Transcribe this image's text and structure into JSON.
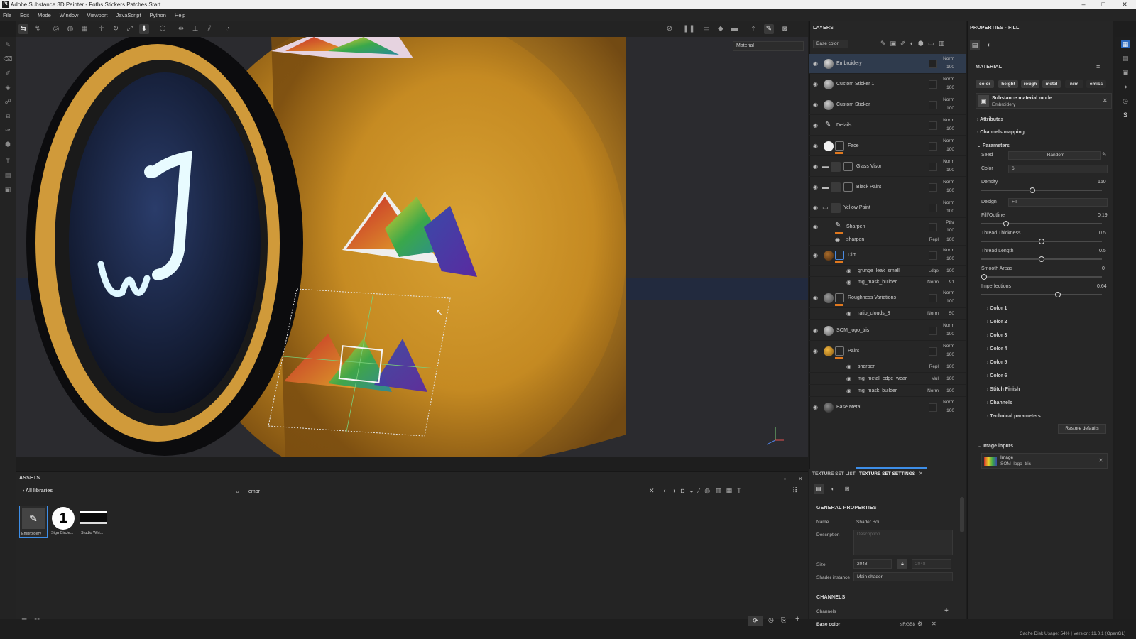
{
  "window": {
    "title": "Adobe Substance 3D Painter - Foths Stickers Patches Start",
    "app_icon": "Pt",
    "controls": {
      "minimize": "–",
      "maximize": "□",
      "close": "✕"
    }
  },
  "menu": [
    "File",
    "Edit",
    "Mode",
    "Window",
    "Viewport",
    "JavaScript",
    "Python",
    "Help"
  ],
  "viewport": {
    "material_dropdown": "Material"
  },
  "layers_panel": {
    "title": "LAYERS",
    "channel_dropdown": "Base color",
    "layers": [
      {
        "name": "Embroidery",
        "blend": "Norm",
        "opacity": "100",
        "selected": true
      },
      {
        "name": "Custom Sticker 1",
        "blend": "Norm",
        "opacity": "100"
      },
      {
        "name": "Custom Sticker",
        "blend": "Norm",
        "opacity": "100"
      },
      {
        "name": "Details",
        "blend": "Norm",
        "opacity": "100"
      },
      {
        "name": "Face",
        "blend": "Norm",
        "opacity": "100"
      },
      {
        "name": "Glass Visor",
        "blend": "Norm",
        "opacity": "100"
      },
      {
        "name": "Black Paint",
        "blend": "Norm",
        "opacity": "100"
      },
      {
        "name": "Yellow Paint",
        "blend": "Norm",
        "opacity": "100"
      },
      {
        "name": "Sharpen",
        "blend": "Pthr",
        "opacity": "100"
      },
      {
        "name": "Dirt",
        "blend": "Norm",
        "opacity": "100"
      },
      {
        "name": "Roughness Variations",
        "blend": "Norm",
        "opacity": "100"
      },
      {
        "name": "SOM_logo_tris",
        "blend": "Norm",
        "opacity": "100"
      },
      {
        "name": "Paint",
        "blend": "Norm",
        "opacity": "100"
      },
      {
        "name": "Base Metal",
        "blend": "Norm",
        "opacity": "100"
      }
    ],
    "effects": [
      {
        "name": "sharpen",
        "blend": "Repl",
        "opacity": "100"
      },
      {
        "name": "grunge_leak_small",
        "blend": "Ldge",
        "opacity": "100"
      },
      {
        "name": "mg_mask_builder",
        "blend": "Norm",
        "opacity": "91"
      },
      {
        "name": "ratio_clouds_3",
        "blend": "Norm",
        "opacity": "50"
      },
      {
        "name": "sharpen",
        "blend": "Repl",
        "opacity": "100"
      },
      {
        "name": "mg_metal_edge_wear",
        "blend": "Mul",
        "opacity": "100"
      },
      {
        "name": "mg_mask_builder",
        "blend": "Norm",
        "opacity": "100"
      }
    ]
  },
  "properties_panel": {
    "title": "PROPERTIES - FILL",
    "material_header": "MATERIAL",
    "channel_pills": [
      "color",
      "height",
      "rough",
      "metal",
      "nrm",
      "emiss"
    ],
    "material_mode_title": "Substance material mode",
    "material_mode_value": "Embroidery",
    "sections": {
      "attributes": "Attributes",
      "channels_mapping": "Channels mapping",
      "parameters": "Parameters"
    },
    "params": {
      "seed_label": "Seed",
      "seed_value": "Random",
      "color_label": "Color",
      "color_value": "6",
      "density_label": "Density",
      "density_value": "150",
      "design_label": "Design",
      "design_value": "Fill",
      "fill_outline_label": "Fill/Outline",
      "fill_outline_value": "0.19",
      "thread_thickness_label": "Thread Thickness",
      "thread_thickness_value": "0.5",
      "thread_length_label": "Thread Length",
      "thread_length_value": "0.5",
      "smooth_areas_label": "Smooth Areas",
      "smooth_areas_value": "0",
      "imperfections_label": "Imperfections",
      "imperfections_value": "0.64"
    },
    "slider_levels": {
      "density": 0.42,
      "fill_outline": 0.19,
      "thread_thickness": 0.5,
      "thread_length": 0.5,
      "smooth_areas": 0.0,
      "imperfections": 0.64
    },
    "collapsed_groups": [
      "Color 1",
      "Color 2",
      "Color 3",
      "Color 4",
      "Color 5",
      "Color 6",
      "Stitch Finish",
      "Channels",
      "Technical parameters"
    ],
    "restore_defaults": "Restore defaults",
    "image_inputs_header": "Image inputs",
    "image_input_label": "Image",
    "image_input_value": "SOM_logo_tris"
  },
  "assets_panel": {
    "title": "ASSETS",
    "library": "All libraries",
    "search_value": "embr",
    "items": [
      {
        "label": "Embroidery"
      },
      {
        "label": "Sign Circle..."
      },
      {
        "label": "Studio Whi..."
      }
    ]
  },
  "texture_set": {
    "tabs": [
      "TEXTURE SET LIST",
      "TEXTURE SET SETTINGS"
    ],
    "general_header": "GENERAL PROPERTIES",
    "name_label": "Name",
    "name_value": "Shader Boi",
    "description_label": "Description",
    "description_placeholder": "Description",
    "size_label": "Size",
    "size_value": "2048",
    "size_value_locked": "2048",
    "shader_label": "Shader instance",
    "shader_value": "Main shader",
    "channels_header": "CHANNELS",
    "channels_label": "Channels",
    "base_color_label": "Base color",
    "base_color_format": "sRGB8"
  },
  "status": {
    "text": "Cache Disk Usage:   54% | Version: 11.0.1 (OpenGL)"
  },
  "colors": {
    "accent": "#3d8ee8",
    "selection": "#2f3b4d",
    "orange": "#e0781e",
    "robot_yellow": "#d49a2c"
  }
}
